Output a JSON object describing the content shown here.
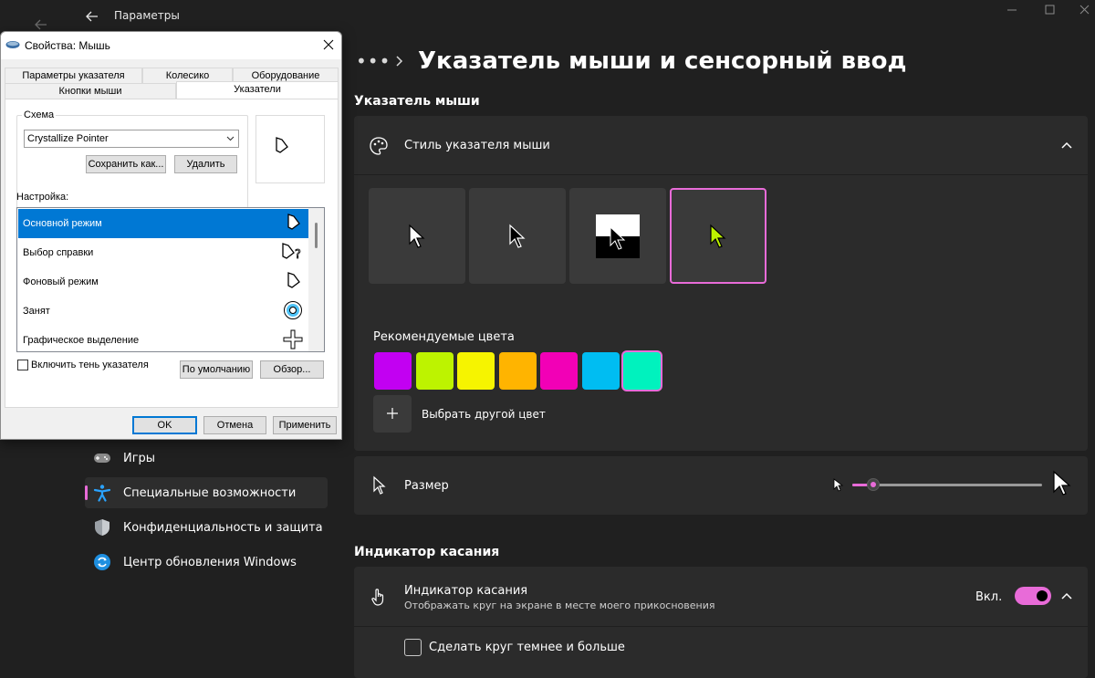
{
  "settings": {
    "window_title": "Параметры",
    "page_title": "Указатель мыши и сенсорный ввод",
    "breadcrumb_more": "•••",
    "section_pointer": "Указатель мыши",
    "pointer_style": {
      "label": "Стиль указателя мыши",
      "options": [
        "white",
        "black",
        "inverted",
        "custom"
      ],
      "selected": "custom"
    },
    "recommended_colors": {
      "label": "Рекомендуемые цвета",
      "colors": [
        "#c200f2",
        "#bdf300",
        "#f6f400",
        "#ffb400",
        "#f200b6",
        "#00bdf2",
        "#00f2be"
      ],
      "selected_index": 6
    },
    "pick_color_label": "Выбрать другой цвет",
    "size": {
      "label": "Размер",
      "value_fraction": 0.11
    },
    "section_touch": "Индикатор касания",
    "touch_indicator": {
      "title": "Индикатор касания",
      "subtitle": "Отображать круг на экране в месте моего прикосновения",
      "state_label": "Вкл."
    },
    "darker_circle_label": "Сделать круг темнее и больше",
    "accent_color": "#e86bd8"
  },
  "nav": {
    "items": [
      {
        "label": "Игры",
        "icon": "gamepad-icon"
      },
      {
        "label": "Специальные возможности",
        "icon": "accessibility-icon",
        "active": true
      },
      {
        "label": "Конфиденциальность и защита",
        "icon": "shield-icon"
      },
      {
        "label": "Центр обновления Windows",
        "icon": "windows-update-icon"
      }
    ]
  },
  "dialog": {
    "title": "Свойства: Мышь",
    "tabs_row1": [
      "Параметры указателя",
      "Колесико",
      "Оборудование"
    ],
    "tabs_row2": [
      "Кнопки мыши",
      "Указатели"
    ],
    "active_tab": "Указатели",
    "scheme_label": "Схема",
    "scheme_value": "Crystallize Pointer",
    "save_as_label": "Сохранить как...",
    "delete_label": "Удалить",
    "customize_label": "Настройка:",
    "cursor_list": [
      {
        "label": "Основной режим",
        "icon": "pointer-icon",
        "selected": true
      },
      {
        "label": "Выбор справки",
        "icon": "help-select-icon"
      },
      {
        "label": "Фоновый режим",
        "icon": "background-pointer-icon"
      },
      {
        "label": "Занят",
        "icon": "busy-icon"
      },
      {
        "label": "Графическое выделение",
        "icon": "crosshair-icon"
      }
    ],
    "shadow_label": "Включить тень указателя",
    "default_label": "По умолчанию",
    "browse_label": "Обзор...",
    "ok_label": "OK",
    "cancel_label": "Отмена",
    "apply_label": "Применить"
  }
}
